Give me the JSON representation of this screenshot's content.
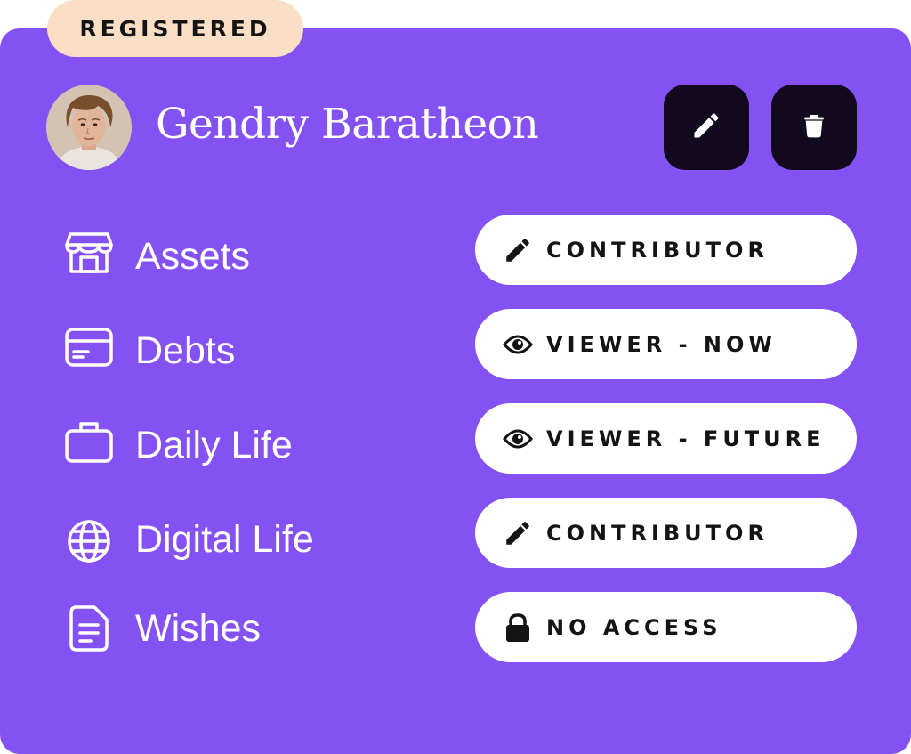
{
  "badge": {
    "label": "REGISTERED"
  },
  "user": {
    "name": "Gendry Baratheon"
  },
  "actions": {
    "edit_icon": "pencil-icon",
    "delete_icon": "trash-icon"
  },
  "colors": {
    "card_background": "#8451F3",
    "badge_background": "#FADFC6",
    "action_button": "#13091E",
    "pill_background": "#FFFFFF"
  },
  "sections": [
    {
      "label": "Assets",
      "icon": "storefront-icon",
      "permission": "CONTRIBUTOR",
      "permission_icon": "pencil-icon"
    },
    {
      "label": "Debts",
      "icon": "credit-card-icon",
      "permission": "VIEWER - NOW",
      "permission_icon": "eye-icon"
    },
    {
      "label": "Daily Life",
      "icon": "briefcase-icon",
      "permission": "VIEWER - FUTURE",
      "permission_icon": "eye-icon"
    },
    {
      "label": "Digital Life",
      "icon": "globe-icon",
      "permission": "CONTRIBUTOR",
      "permission_icon": "pencil-icon"
    },
    {
      "label": "Wishes",
      "icon": "document-icon",
      "permission": "NO ACCESS",
      "permission_icon": "lock-icon"
    }
  ]
}
